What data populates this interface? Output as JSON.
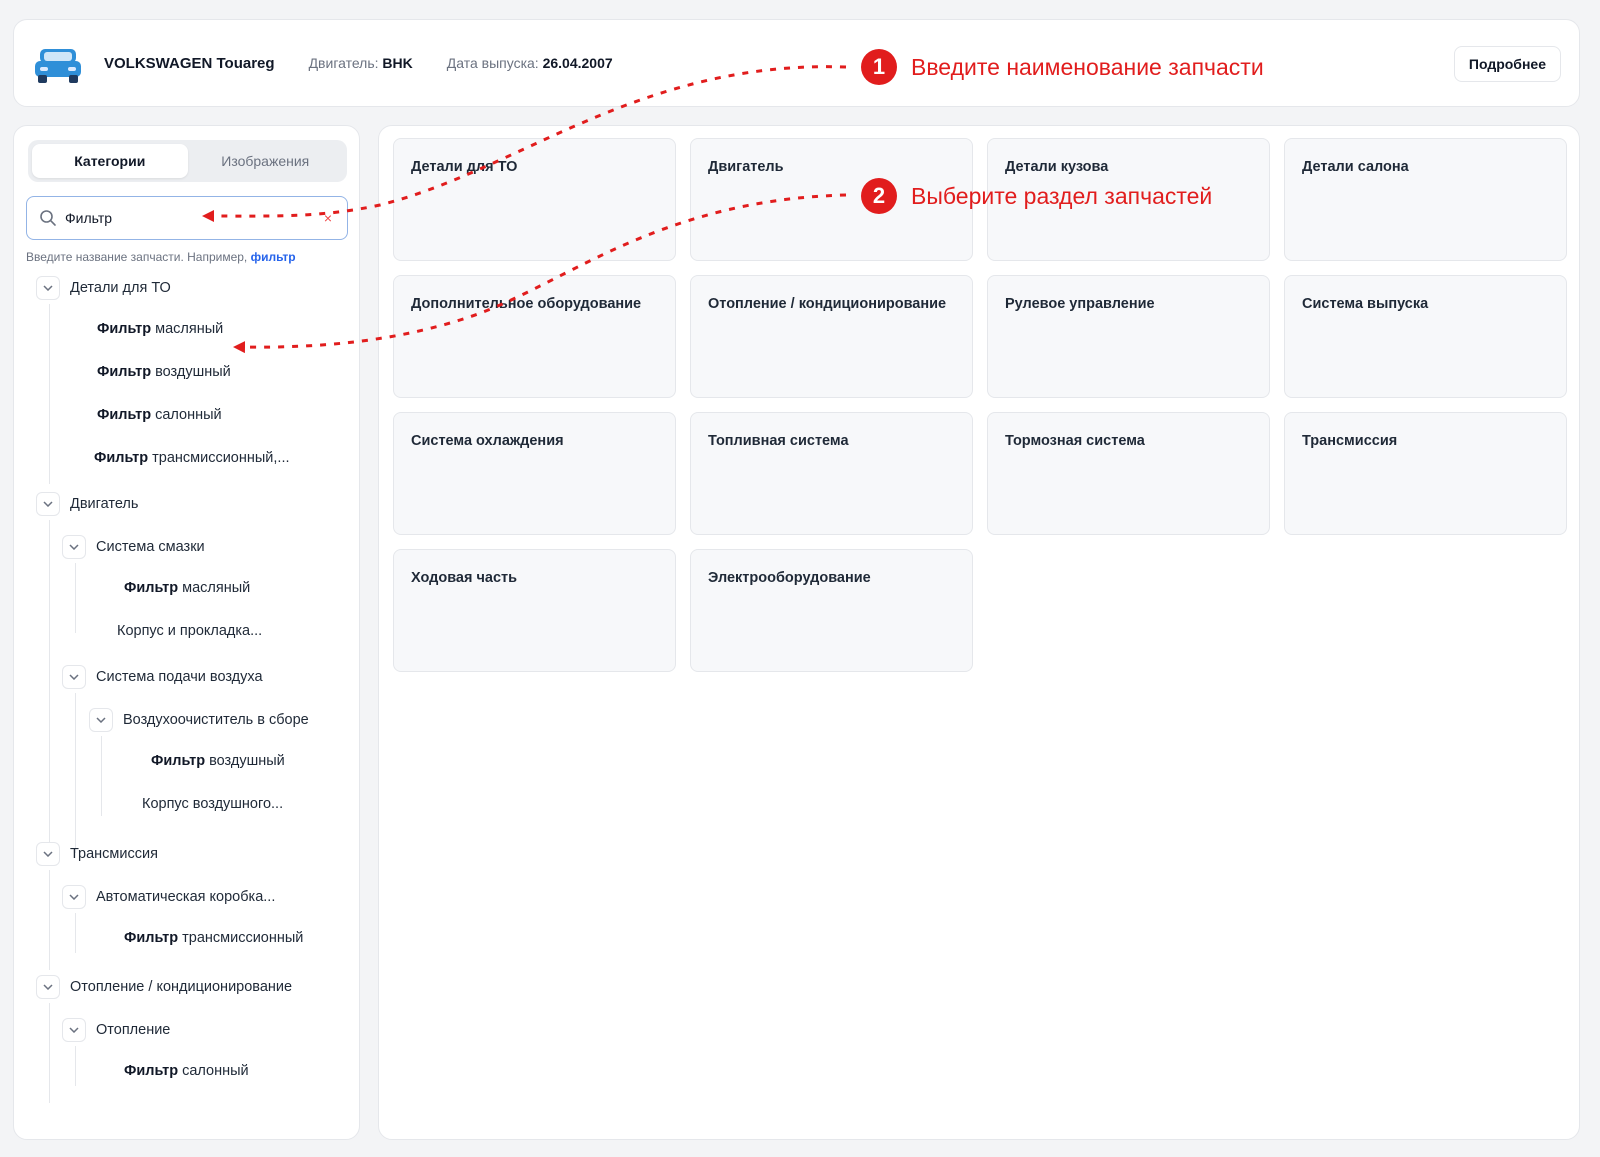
{
  "header": {
    "car_title": "VOLKSWAGEN Touareg",
    "engine_label": "Двигатель:",
    "engine_value": "BHK",
    "date_label": "Дата выпуска:",
    "date_value": "26.04.2007",
    "more_button": "Подробнее"
  },
  "sidebar": {
    "tabs": [
      {
        "label": "Категории",
        "active": true
      },
      {
        "label": "Изображения",
        "active": false
      }
    ],
    "search": {
      "value": "Фильтр"
    },
    "hint_text": "Введите название запчасти. Например,",
    "hint_link": "фильтр",
    "tree": [
      {
        "label": "Детали для ТО",
        "expanded": true
      },
      {
        "bold": "Фильтр",
        "rest": "масляный"
      },
      {
        "bold": "Фильтр",
        "rest": "воздушный"
      },
      {
        "bold": "Фильтр",
        "rest": "салонный"
      },
      {
        "bold": "Фильтр",
        "rest": "трансмиссионный,..."
      },
      {
        "label": "Двигатель",
        "expanded": true
      },
      {
        "label": "Система смазки",
        "expanded": true
      },
      {
        "bold": "Фильтр",
        "rest": "масляный"
      },
      {
        "label": "Корпус и прокладка..."
      },
      {
        "label": "Система подачи воздуха",
        "expanded": true
      },
      {
        "label": "Воздухоочиститель в сборе",
        "expanded": true
      },
      {
        "bold": "Фильтр",
        "rest": "воздушный"
      },
      {
        "label": "Корпус воздушного..."
      },
      {
        "label": "Трансмиссия",
        "expanded": true
      },
      {
        "label": "Автоматическая коробка...",
        "expanded": true
      },
      {
        "bold": "Фильтр",
        "rest": "трансмиссионный"
      },
      {
        "label": "Отопление / кондиционирование",
        "expanded": true
      },
      {
        "label": "Отопление",
        "expanded": true
      },
      {
        "bold": "Фильтр",
        "rest": "салонный"
      }
    ]
  },
  "categories": [
    "Детали для ТО",
    "Двигатель",
    "Детали кузова",
    "Детали салона",
    "Дополнительное оборудование",
    "Отопление / кондиционирование",
    "Рулевое управление",
    "Система выпуска",
    "Система охлаждения",
    "Топливная система",
    "Тормозная система",
    "Трансмиссия",
    "Ходовая часть",
    "Электрооборудование"
  ],
  "annotations": [
    {
      "number": "1",
      "text": "Введите наименование запчасти"
    },
    {
      "number": "2",
      "text": "Выберите раздел запчастей"
    }
  ],
  "colors": {
    "annotation": "#e11d1d",
    "link": "#2563eb",
    "car": "#2f8fd8"
  }
}
